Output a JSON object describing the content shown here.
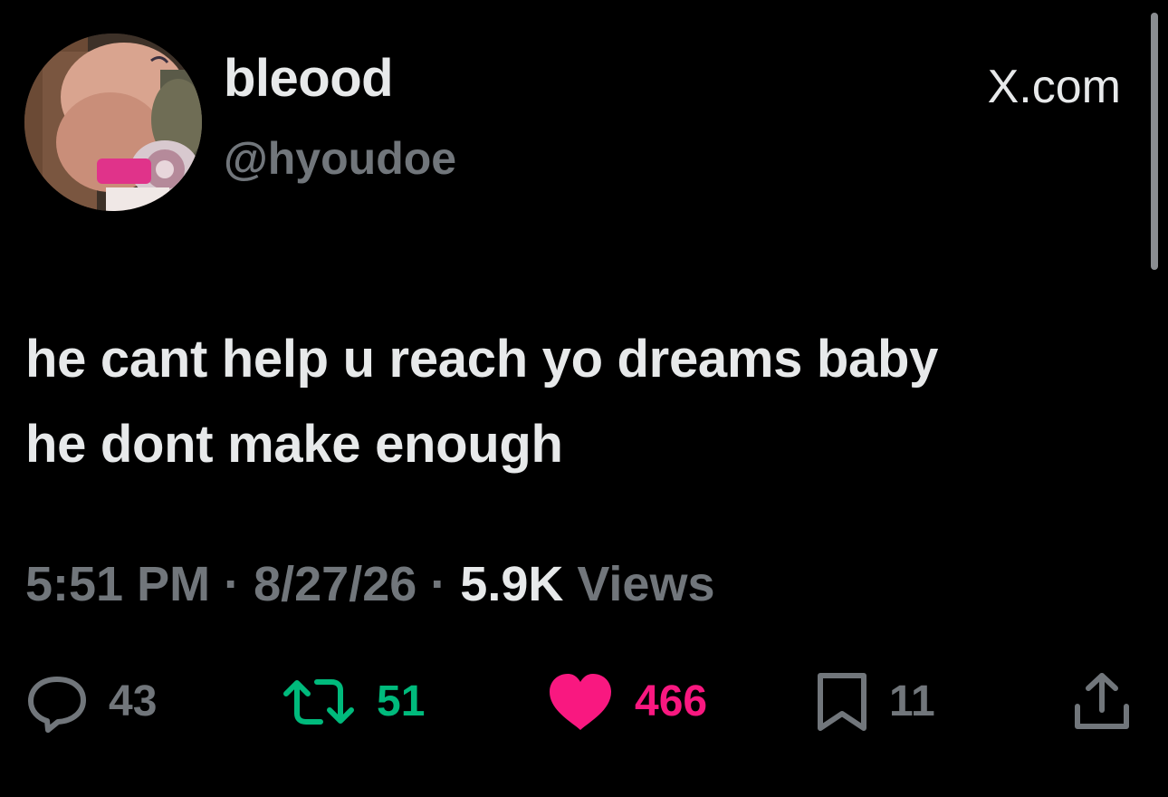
{
  "author": {
    "display_name": "bleood",
    "handle": "@hyoudoe"
  },
  "site_label": "X.com",
  "tweet": {
    "lines": [
      "he cant help u reach yo dreams baby",
      "he dont make enough"
    ]
  },
  "meta": {
    "time": "5:51 PM",
    "date": "8/27/26",
    "separator": "·",
    "views_count": "5.9K",
    "views_label": "Views"
  },
  "actions": {
    "reply": {
      "icon": "reply-icon",
      "count": "43"
    },
    "retweet": {
      "icon": "retweet-icon",
      "count": "51",
      "color": "#00ba7c"
    },
    "like": {
      "icon": "heart-icon",
      "count": "466",
      "color": "#f91880",
      "liked": true
    },
    "bookmark": {
      "icon": "bookmark-icon",
      "count": "11"
    },
    "share": {
      "icon": "share-icon"
    }
  },
  "colors": {
    "background": "#000000",
    "primary_text": "#e7e9ea",
    "secondary_text": "#71767b"
  }
}
